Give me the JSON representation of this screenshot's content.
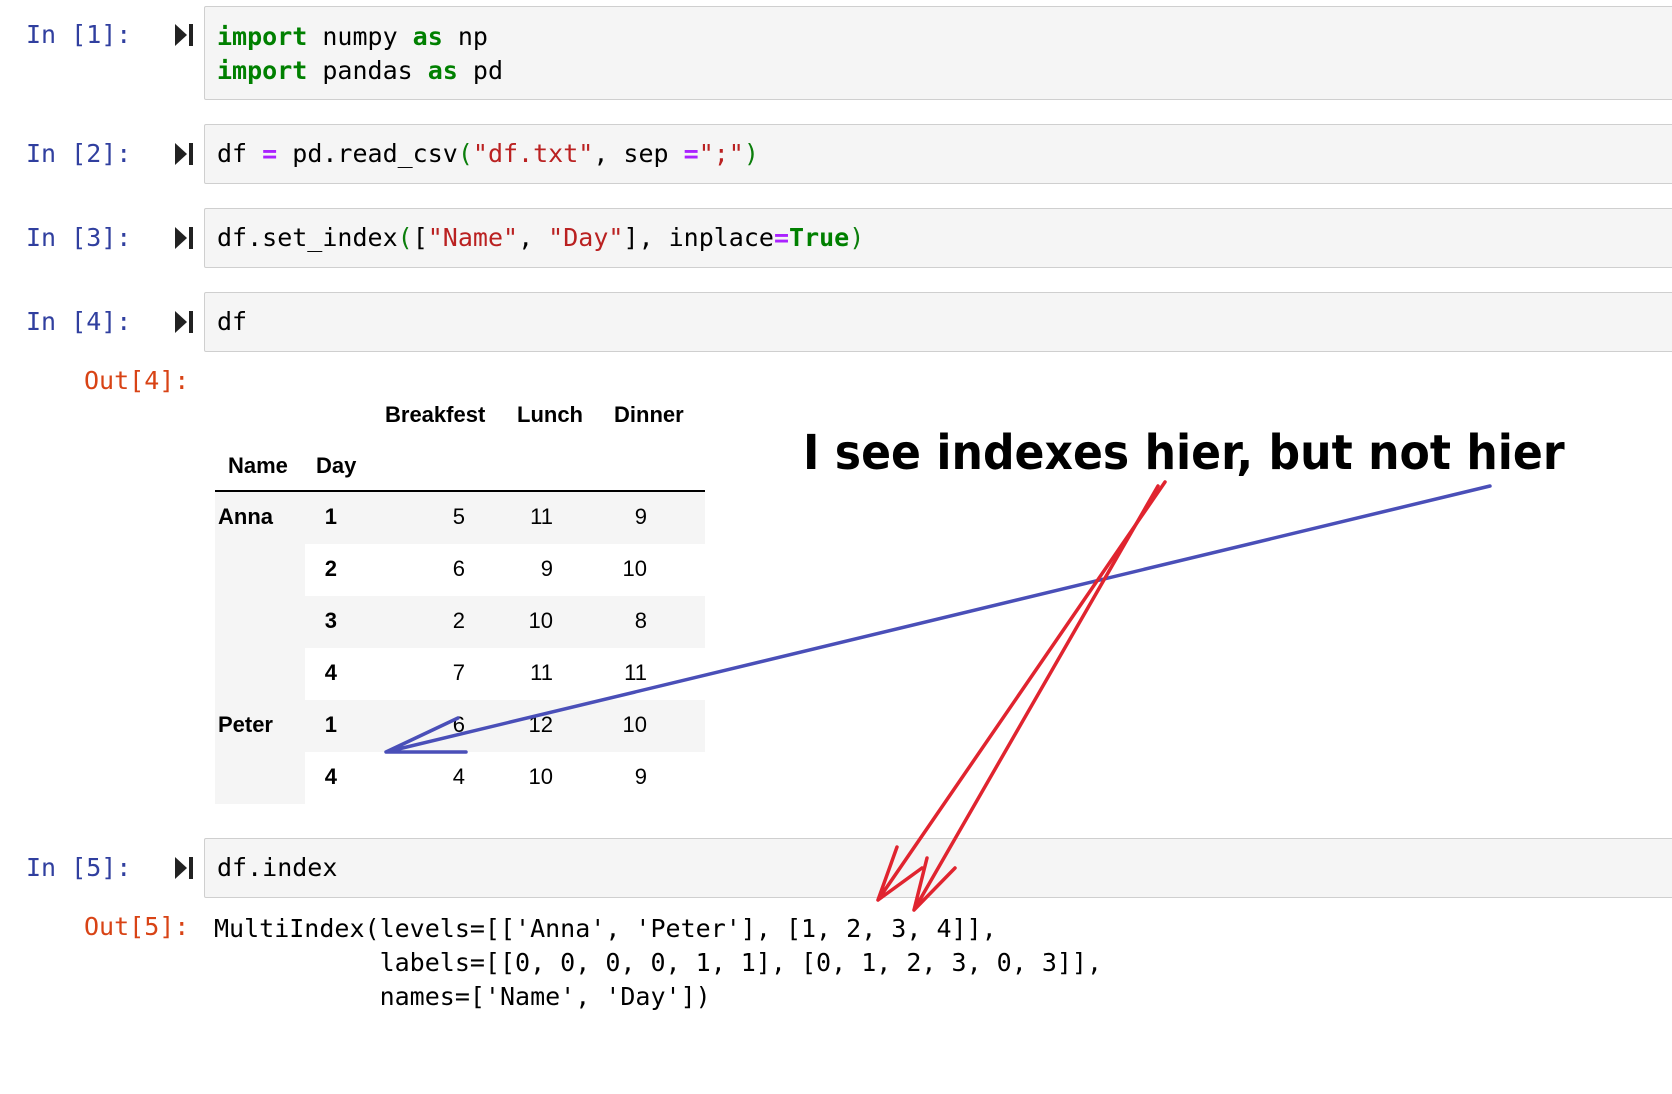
{
  "cells": [
    {
      "prompt": "In [1]:",
      "lines": [
        [
          {
            "t": "import",
            "c": "kw"
          },
          {
            "t": " numpy ",
            "c": ""
          },
          {
            "t": "as",
            "c": "kw"
          },
          {
            "t": " np",
            "c": ""
          }
        ],
        [
          {
            "t": "import",
            "c": "kw"
          },
          {
            "t": " pandas ",
            "c": ""
          },
          {
            "t": "as",
            "c": "kw"
          },
          {
            "t": " pd",
            "c": ""
          }
        ]
      ]
    },
    {
      "prompt": "In [2]:",
      "lines": [
        [
          {
            "t": "df ",
            "c": ""
          },
          {
            "t": "=",
            "c": "op"
          },
          {
            "t": " pd.read_csv",
            "c": ""
          },
          {
            "t": "(",
            "c": "brk"
          },
          {
            "t": "\"df.txt\"",
            "c": "str"
          },
          {
            "t": ", sep ",
            "c": ""
          },
          {
            "t": "=",
            "c": "op"
          },
          {
            "t": "\";\"",
            "c": "str"
          },
          {
            "t": ")",
            "c": "brk"
          }
        ]
      ]
    },
    {
      "prompt": "In [3]:",
      "lines": [
        [
          {
            "t": "df.set_index",
            "c": ""
          },
          {
            "t": "(",
            "c": "brk"
          },
          {
            "t": "[",
            "c": ""
          },
          {
            "t": "\"Name\"",
            "c": "str"
          },
          {
            "t": ", ",
            "c": ""
          },
          {
            "t": "\"Day\"",
            "c": "str"
          },
          {
            "t": "], inplace",
            "c": ""
          },
          {
            "t": "=",
            "c": "op"
          },
          {
            "t": "True",
            "c": "kw"
          },
          {
            "t": ")",
            "c": "brk"
          }
        ]
      ]
    },
    {
      "prompt": "In [4]:",
      "lines": [
        [
          {
            "t": "df",
            "c": ""
          }
        ]
      ]
    },
    {
      "prompt": "In [5]:",
      "lines": [
        [
          {
            "t": "df.index",
            "c": ""
          }
        ]
      ]
    }
  ],
  "outputs": {
    "out4_prompt": "Out[4]:",
    "out5_prompt": "Out[5]:",
    "out5_text": "MultiIndex(levels=[['Anna', 'Peter'], [1, 2, 3, 4]],\n           labels=[[0, 0, 0, 0, 1, 1], [0, 1, 2, 3, 0, 3]],\n           names=['Name', 'Day'])"
  },
  "dataframe": {
    "columns": [
      "Breakfest",
      "Lunch",
      "Dinner"
    ],
    "index_names": [
      "Name",
      "Day"
    ],
    "rows": [
      {
        "name": "Anna",
        "day": "1",
        "values": [
          "5",
          "11",
          "9"
        ]
      },
      {
        "name": "",
        "day": "2",
        "values": [
          "6",
          "9",
          "10"
        ]
      },
      {
        "name": "",
        "day": "3",
        "values": [
          "2",
          "10",
          "8"
        ]
      },
      {
        "name": "",
        "day": "4",
        "values": [
          "7",
          "11",
          "11"
        ]
      },
      {
        "name": "Peter",
        "day": "1",
        "values": [
          "6",
          "12",
          "10"
        ]
      },
      {
        "name": "",
        "day": "4",
        "values": [
          "4",
          "10",
          "9"
        ]
      }
    ]
  },
  "annotation": {
    "text": "I see indexes hier, but not hier",
    "red_arrow_color": "#e0242f",
    "blue_arrow_color": "#4a4fb8"
  },
  "icons": {
    "run": "run-cell-icon"
  }
}
